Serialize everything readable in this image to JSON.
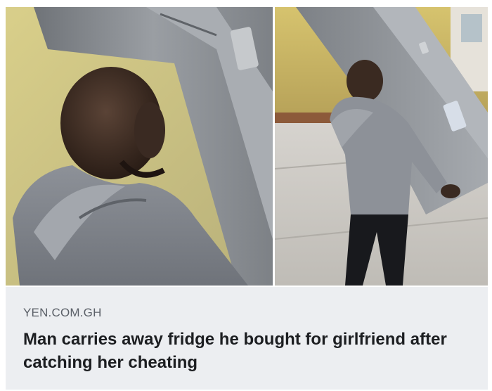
{
  "link_preview": {
    "source": "YEN.COM.GH",
    "headline": "Man carries away fridge he bought for girlfriend after catching her cheating",
    "images": [
      {
        "name": "photo-closeup",
        "depicts": "man-in-grey-hoodie-carrying-silver-fridge-closeup"
      },
      {
        "name": "photo-wide",
        "depicts": "man-walking-with-fridge-on-back-outdoors"
      }
    ]
  }
}
